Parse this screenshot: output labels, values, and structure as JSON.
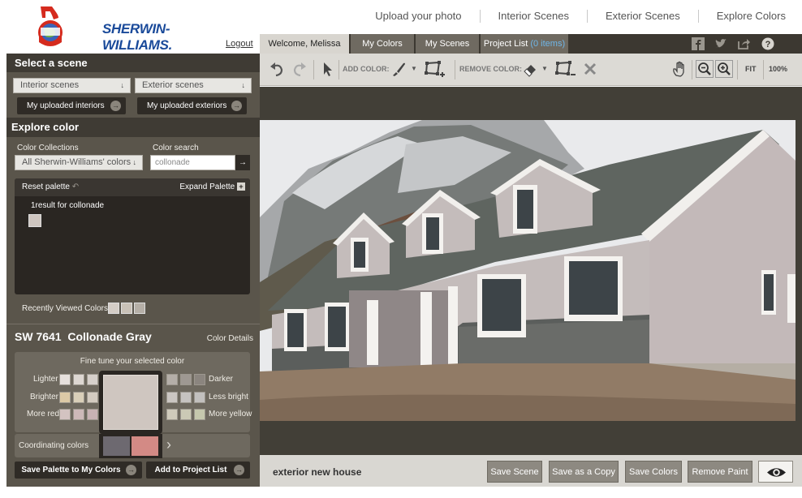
{
  "brand": {
    "name": "SHERWIN-WILLIAMS.",
    "accent": "#1a4a9a",
    "logo_red": "#d52b1e"
  },
  "topnav": [
    "Upload your photo",
    "Interior Scenes",
    "Exterior Scenes",
    "Explore Colors"
  ],
  "logout": "Logout",
  "tabs": {
    "welcome": "Welcome, Melissa",
    "my_colors": "My Colors",
    "my_scenes": "My Scenes",
    "project_list": "Project List",
    "project_count": "(0 items)"
  },
  "social_icons": [
    "facebook-icon",
    "twitter-icon",
    "share-icon",
    "help-icon"
  ],
  "select_scene": {
    "title": "Select a scene",
    "interior_dropdown": "Interior scenes",
    "exterior_dropdown": "Exterior scenes",
    "uploaded_interiors": "My uploaded interiors",
    "uploaded_exteriors": "My uploaded exteriors"
  },
  "explore": {
    "title": "Explore color",
    "collections_label": "Color Collections",
    "collections_value": "All Sherwin-Williams' colors",
    "search_label": "Color search",
    "search_value": "collonade",
    "reset_palette": "Reset palette",
    "expand_palette": "Expand Palette",
    "result_count": "1result for",
    "result_term": "collonade",
    "recently_viewed": "Recently Viewed Colors",
    "result_chip_color": "#cfc6c0",
    "recent_colors": [
      "#d4cdc6",
      "#c9c1b7",
      "#b5afa7"
    ]
  },
  "selected_color": {
    "code": "SW 7641",
    "name": "Collonade Gray",
    "details_link": "Color Details",
    "hex": "#cfc6c0",
    "fine_tune_title": "Fine tune your selected color",
    "lighter": "Lighter",
    "darker": "Darker",
    "brighter": "Brighter",
    "less_bright": "Less bright",
    "more_red": "More red",
    "more_yellow": "More yellow",
    "coordinating": "Coordinating colors",
    "coordinating_colors": [
      "#6d6970",
      "#d38a85"
    ],
    "lighter_swatches": [
      "#e6e0dc",
      "#ddd7d2",
      "#d6d0cb"
    ],
    "darker_swatches": [
      "#b4aea8",
      "#9e9892",
      "#8b857f"
    ],
    "brighter_swatches": [
      "#dcc9a6",
      "#d9cfb9",
      "#d3cbc0"
    ],
    "less_bright_swatches": [
      "#cbc6c2",
      "#c6c3c0",
      "#c2c0be"
    ],
    "more_red_swatches": [
      "#d3c3c1",
      "#cdb9b9",
      "#c8b2b4"
    ],
    "more_yellow_swatches": [
      "#cfcabb",
      "#cbc9b5",
      "#c5c7ad"
    ]
  },
  "left_buttons": {
    "save_palette": "Save Palette to My Colors",
    "add_project": "Add to Project List"
  },
  "toolbar": {
    "add_color": "ADD COLOR:",
    "remove_color": "REMOVE COLOR:",
    "fit": "FIT",
    "zoom": "100%"
  },
  "scene": {
    "name": "exterior new house",
    "save_scene": "Save Scene",
    "save_copy": "Save as a Copy",
    "save_colors": "Save Colors",
    "remove_paint": "Remove Paint"
  }
}
